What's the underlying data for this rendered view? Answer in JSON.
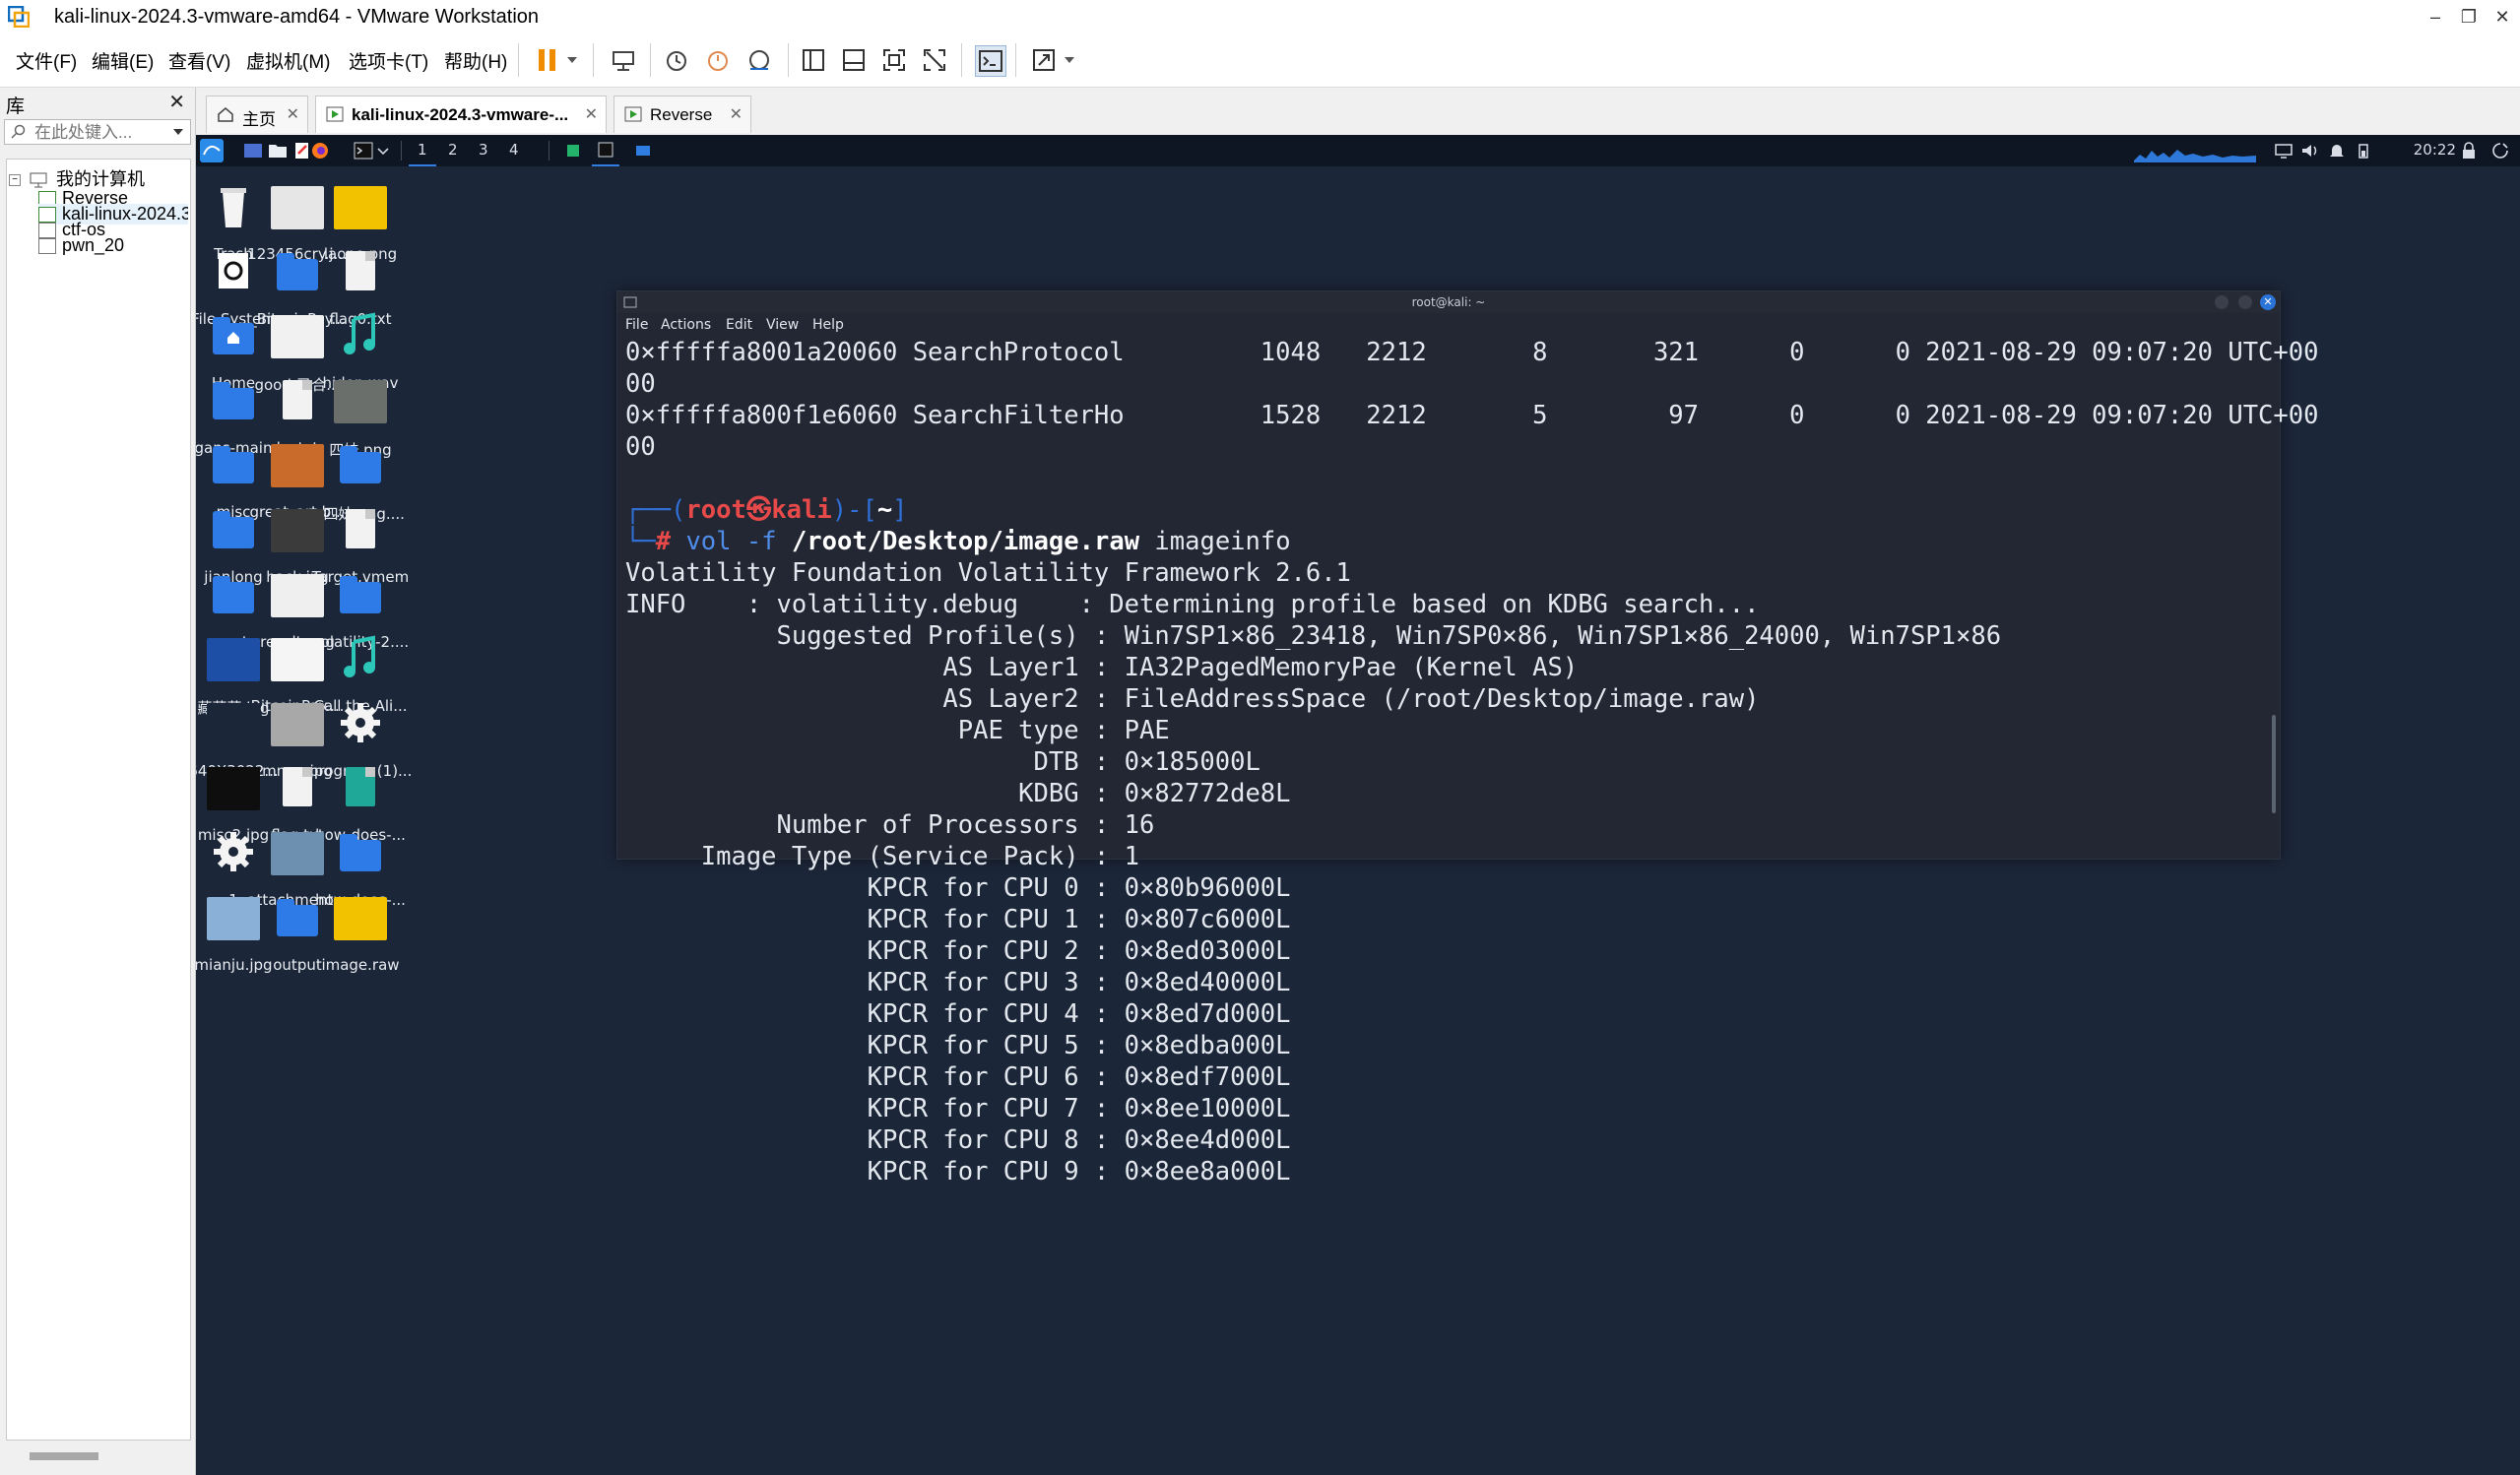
{
  "window": {
    "title": "kali-linux-2024.3-vmware-amd64 - VMware Workstation",
    "controls": [
      "–",
      "❐",
      "✕"
    ]
  },
  "menu": [
    "文件(F)",
    "编辑(E)",
    "查看(V)",
    "虚拟机(M)",
    "选项卡(T)",
    "帮助(H)"
  ],
  "library": {
    "title": "库",
    "search_placeholder": "在此处键入...",
    "root": "我的计算机",
    "items": [
      "Reverse",
      "kali-linux-2024.3",
      "ctf-os",
      "pwn_20"
    ]
  },
  "tabs": [
    {
      "label": "主页"
    },
    {
      "label": "kali-linux-2024.3-vmware-..."
    },
    {
      "label": "Reverse"
    }
  ],
  "panel": {
    "workspaces": [
      "1",
      "2",
      "3",
      "4"
    ],
    "clock": "20:22"
  },
  "desktop": [
    [
      "Trash",
      "123456cry.j...",
      "laopo.png"
    ],
    [
      "File System",
      "_BitcoinPay...",
      "flag0.txt"
    ],
    [
      "Home",
      "good-已合...",
      "hiden.wav"
    ],
    [
      "gaps-main",
      "ko.txt",
      "四妹.png"
    ],
    [
      "misc",
      "great_art.b...",
      "_四妹.png...."
    ],
    [
      "jianlong",
      "hack.jpg",
      "Target.vmem"
    ],
    [
      "crypto",
      "result.png",
      "volatility-2...."
    ],
    [
      "藏藏藏.jpg",
      "BitcoinPay....",
      "Call the Ali..."
    ],
    [
      "640X3022...",
      "mmm.jpg",
      "program (1)..."
    ],
    [
      "misc2.jpg",
      "flag.txt",
      "how-does-..."
    ],
    [
      "1",
      "attachment...",
      "how-does-..."
    ],
    [
      "mianju.jpg",
      "output",
      "image.raw"
    ]
  ],
  "terminal": {
    "title": "root@kali: ~",
    "menu": [
      "File",
      "Actions",
      "Edit",
      "View",
      "Help"
    ],
    "pre_lines": [
      "0×fffffa8001a20060 SearchProtocol         1048   2212       8       321      0      0 2021-08-29 09:07:20 UTC+00",
      "00",
      "0×fffffa800f1e6060 SearchFilterHo         1528   2212       5        97      0      0 2021-08-29 09:07:20 UTC+00",
      "00",
      ""
    ],
    "prompt": {
      "top_open": "┌──(",
      "user": "root㉿kali",
      "top_close": ")-[",
      "dir": "~",
      "top_end": "]",
      "bottom": "└─",
      "hash": "#",
      "cmd": "vol",
      "flag": "-f",
      "path": "/root/Desktop/image.raw",
      "arg": "imageinfo"
    },
    "output_lines": [
      "Volatility Foundation Volatility Framework 2.6.1",
      "INFO    : volatility.debug    : Determining profile based on KDBG search...",
      "          Suggested Profile(s) : Win7SP1×86_23418, Win7SP0×86, Win7SP1×86_24000, Win7SP1×86",
      "                     AS Layer1 : IA32PagedMemoryPae (Kernel AS)",
      "                     AS Layer2 : FileAddressSpace (/root/Desktop/image.raw)",
      "                      PAE type : PAE",
      "                           DTB : 0×185000L",
      "                          KDBG : 0×82772de8L",
      "          Number of Processors : 16",
      "     Image Type (Service Pack) : 1",
      "                KPCR for CPU 0 : 0×80b96000L",
      "                KPCR for CPU 1 : 0×807c6000L",
      "                KPCR for CPU 2 : 0×8ed03000L",
      "                KPCR for CPU 3 : 0×8ed40000L",
      "                KPCR for CPU 4 : 0×8ed7d000L",
      "                KPCR for CPU 5 : 0×8edba000L",
      "                KPCR for CPU 6 : 0×8edf7000L",
      "                KPCR for CPU 7 : 0×8ee10000L",
      "                KPCR for CPU 8 : 0×8ee4d000L",
      "                KPCR for CPU 9 : 0×8ee8a000L"
    ]
  },
  "colors": {
    "desktop_bg": "#1b2638",
    "terminal_bg": "#232733",
    "prompt_blue": "#2f6fd6",
    "prompt_red": "#e84a4a",
    "folder_blue": "#2e7be8"
  }
}
